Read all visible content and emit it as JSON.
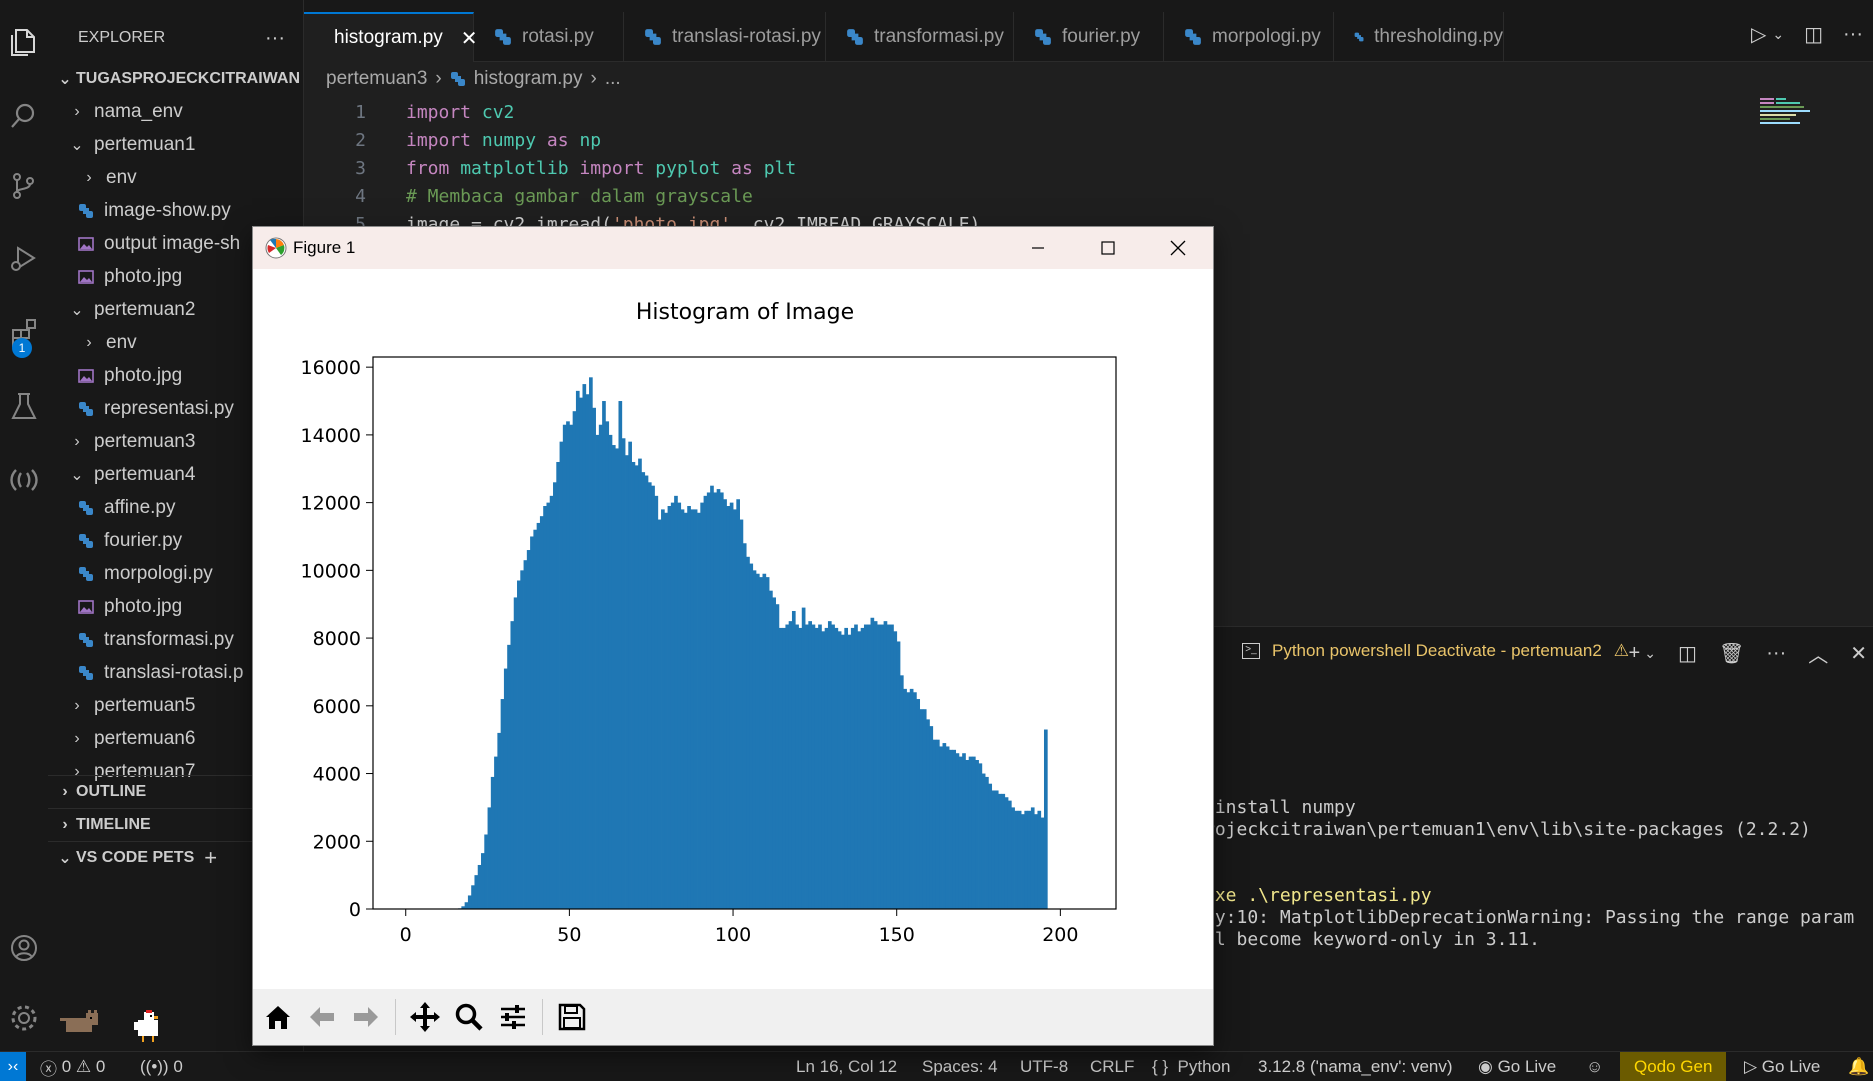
{
  "explorer": {
    "title": "EXPLORER",
    "more": "···",
    "root": "TUGASPROJECKCITRAIWAN",
    "items": [
      {
        "label": "nama_env",
        "type": "folder",
        "open": false,
        "depth": 0
      },
      {
        "label": "pertemuan1",
        "type": "folder",
        "open": true,
        "depth": 0
      },
      {
        "label": "env",
        "type": "folder",
        "open": false,
        "depth": 1
      },
      {
        "label": "image-show.py",
        "type": "py",
        "depth": 1
      },
      {
        "label": "output image-sh",
        "type": "img",
        "depth": 1
      },
      {
        "label": "photo.jpg",
        "type": "img",
        "depth": 1
      },
      {
        "label": "pertemuan2",
        "type": "folder",
        "open": true,
        "depth": 0
      },
      {
        "label": "env",
        "type": "folder",
        "open": false,
        "depth": 1
      },
      {
        "label": "photo.jpg",
        "type": "img",
        "depth": 1
      },
      {
        "label": "representasi.py",
        "type": "py",
        "depth": 1
      },
      {
        "label": "pertemuan3",
        "type": "folder",
        "open": false,
        "depth": 0
      },
      {
        "label": "pertemuan4",
        "type": "folder",
        "open": true,
        "depth": 0
      },
      {
        "label": "affine.py",
        "type": "py",
        "depth": 1
      },
      {
        "label": "fourier.py",
        "type": "py",
        "depth": 1
      },
      {
        "label": "morpologi.py",
        "type": "py",
        "depth": 1
      },
      {
        "label": "photo.jpg",
        "type": "img",
        "depth": 1
      },
      {
        "label": "transformasi.py",
        "type": "py",
        "depth": 1
      },
      {
        "label": "translasi-rotasi.p",
        "type": "py",
        "depth": 1
      },
      {
        "label": "pertemuan5",
        "type": "folder",
        "open": false,
        "depth": 0
      },
      {
        "label": "pertemuan6",
        "type": "folder",
        "open": false,
        "depth": 0
      },
      {
        "label": "pertemuan7",
        "type": "folder",
        "open": false,
        "depth": 0
      }
    ],
    "sections": [
      "OUTLINE",
      "TIMELINE",
      "VS CODE PETS"
    ]
  },
  "activity": {
    "extensions_badge": "1"
  },
  "tabs": [
    {
      "label": "histogram.py",
      "active": true
    },
    {
      "label": "rotasi.py"
    },
    {
      "label": "translasi-rotasi.py"
    },
    {
      "label": "transformasi.py"
    },
    {
      "label": "fourier.py"
    },
    {
      "label": "morpologi.py"
    },
    {
      "label": "thresholding.py"
    }
  ],
  "breadcrumb": {
    "folder": "pertemuan3",
    "file": "histogram.py",
    "more": "..."
  },
  "code": [
    {
      "n": "1",
      "parts": [
        [
          "kw",
          "import"
        ],
        [
          "plain",
          " "
        ],
        [
          "mod",
          "cv2"
        ]
      ]
    },
    {
      "n": "2",
      "parts": [
        [
          "kw",
          "import"
        ],
        [
          "plain",
          " "
        ],
        [
          "mod",
          "numpy"
        ],
        [
          "plain",
          " "
        ],
        [
          "kw",
          "as"
        ],
        [
          "plain",
          " "
        ],
        [
          "mod",
          "np"
        ]
      ]
    },
    {
      "n": "3",
      "parts": [
        [
          "kw",
          "from"
        ],
        [
          "plain",
          " "
        ],
        [
          "mod",
          "matplotlib"
        ],
        [
          "plain",
          " "
        ],
        [
          "kw",
          "import"
        ],
        [
          "plain",
          " "
        ],
        [
          "mod",
          "pyplot"
        ],
        [
          "plain",
          " "
        ],
        [
          "kw",
          "as"
        ],
        [
          "plain",
          " "
        ],
        [
          "mod",
          "plt"
        ]
      ]
    },
    {
      "n": "4",
      "parts": [
        [
          "cm",
          "# Membaca gambar dalam grayscale"
        ]
      ]
    },
    {
      "n": "5",
      "parts": [
        [
          "plain",
          "image = cv2.imread("
        ],
        [
          "str",
          "'photo.jpg'"
        ],
        [
          "plain",
          ", cv2.IMREAD_GRAYSCALE)"
        ]
      ]
    }
  ],
  "terminal": {
    "title": "Python powershell Deactivate - pertemuan2",
    "lines": [
      {
        "text": " install numpy",
        "style": "plain"
      },
      {
        "text": "rojeckcitraiwan\\pertemuan1\\env\\lib\\site-packages (2.2.2)",
        "style": "plain"
      },
      {
        "text": "",
        "style": "plain"
      },
      {
        "text": "",
        "style": "plain"
      },
      {
        "text": "exe .\\representasi.py",
        "style": "y"
      },
      {
        "text": "py:10: MatplotlibDeprecationWarning: Passing the range param",
        "style": "plain"
      },
      {
        "text": "ll become keyword-only in 3.11.",
        "style": "plain"
      }
    ]
  },
  "statusbar": {
    "errors": "0",
    "warnings": "0",
    "ports": "0",
    "position": "Ln 16, Col 12",
    "spaces": "Spaces: 4",
    "encoding": "UTF-8",
    "eol": "CRLF",
    "language": "Python",
    "interpreter": "3.12.8 ('nama_env': venv)",
    "golive1": "Go Live",
    "qodo": "Qodo Gen",
    "golive2": "Go Live"
  },
  "figure": {
    "title": "Figure 1"
  },
  "chart_data": {
    "type": "bar",
    "title": "Histogram of Image",
    "xlabel": "",
    "ylabel": "",
    "xlim": [
      -10,
      217
    ],
    "ylim": [
      0,
      16300
    ],
    "xticks": [
      0,
      50,
      100,
      150,
      200
    ],
    "yticks": [
      0,
      2000,
      4000,
      6000,
      8000,
      10000,
      12000,
      14000,
      16000
    ],
    "color": "#1f77b4",
    "bin_start": 0,
    "bin_width": 1,
    "values": [
      0,
      0,
      0,
      0,
      0,
      0,
      0,
      0,
      0,
      0,
      0,
      0,
      0,
      0,
      0,
      0,
      20,
      80,
      200,
      400,
      700,
      1000,
      1300,
      1650,
      2200,
      3000,
      3900,
      4500,
      5200,
      6200,
      7100,
      7800,
      8500,
      9200,
      9700,
      10000,
      10300,
      10600,
      11000,
      11200,
      11400,
      11600,
      11900,
      12000,
      12200,
      12600,
      13200,
      13800,
      14300,
      14400,
      14300,
      14700,
      15300,
      15100,
      15500,
      15200,
      15700,
      14800,
      14000,
      14300,
      15000,
      14400,
      14000,
      13700,
      13600,
      15000,
      13900,
      13400,
      13800,
      13200,
      13100,
      13300,
      12900,
      12800,
      12600,
      12500,
      12200,
      11500,
      11800,
      11700,
      11900,
      12000,
      12200,
      12000,
      11800,
      11700,
      11900,
      11800,
      11800,
      11700,
      12000,
      12200,
      12300,
      12500,
      12300,
      12400,
      12300,
      12100,
      11900,
      12000,
      11800,
      12100,
      11500,
      10800,
      10400,
      10200,
      10000,
      9900,
      9800,
      9900,
      9800,
      9400,
      9200,
      9000,
      8300,
      8300,
      8400,
      8500,
      8800,
      8400,
      8300,
      8900,
      8400,
      8500,
      8400,
      8300,
      8400,
      8200,
      8300,
      8500,
      8400,
      8300,
      8200,
      8100,
      8300,
      8100,
      8300,
      8400,
      8200,
      8300,
      8400,
      8400,
      8600,
      8500,
      8400,
      8400,
      8500,
      8400,
      8400,
      8200,
      7900,
      6900,
      6500,
      6400,
      6500,
      6400,
      6200,
      5900,
      5900,
      5600,
      5400,
      5000,
      5000,
      4800,
      4900,
      4800,
      4700,
      4700,
      4600,
      4500,
      4600,
      4400,
      4500,
      4500,
      4400,
      4300,
      4000,
      3900,
      3700,
      3500,
      3500,
      3400,
      3400,
      3300,
      3200,
      3000,
      2900,
      2900,
      2800,
      2900,
      2900,
      3000,
      2800,
      2900,
      2700,
      5300
    ],
    "grid": false,
    "legend": "none"
  }
}
